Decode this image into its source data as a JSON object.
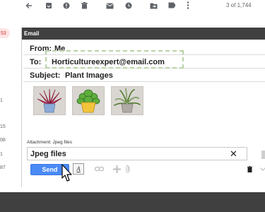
{
  "toolbar": {
    "icons": [
      "back-arrow-icon",
      "archive-icon",
      "report-spam-icon",
      "delete-icon",
      "mark-unread-icon",
      "snooze-icon",
      "move-to-icon",
      "label-icon",
      "more-icon"
    ],
    "counter": "3 of 1,744"
  },
  "left_strip": {
    "badge": "53",
    "counts": [
      "1",
      "15",
      "08",
      "1",
      "87"
    ]
  },
  "compose": {
    "header_title": "Email",
    "from_label": "From:",
    "from_value": "Me",
    "to_label": "To:",
    "to_value": "Horticultureexpert@email.com",
    "subject_label": "Subject:",
    "subject_value": "Plant Images",
    "attachments": [
      {
        "icon": "pink-flower-plant-image"
      },
      {
        "icon": "green-plant-yellow-pot-image"
      },
      {
        "icon": "spider-plant-image"
      }
    ],
    "attachment_caption": "Attachment: Jpeg files",
    "attachment_field_value": "Jpeg files",
    "attachment_close": "✕",
    "send_label": "Send",
    "format_label": "A"
  },
  "colors": {
    "header_bg": "#404040",
    "send_blue": "#4a8af4",
    "highlight_dash": "#b9d3a6",
    "badge_red": "#d93025"
  }
}
